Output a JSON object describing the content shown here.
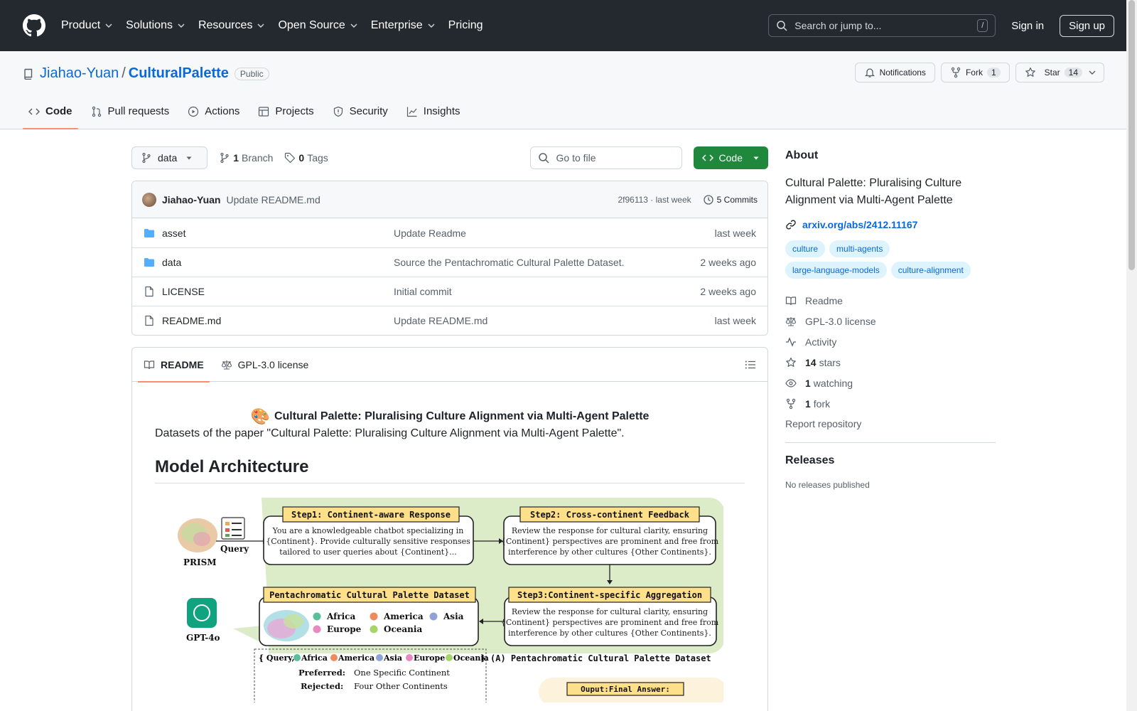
{
  "header": {
    "nav": [
      "Product",
      "Solutions",
      "Resources",
      "Open Source",
      "Enterprise",
      "Pricing"
    ],
    "search_placeholder": "Search or jump to...",
    "search_key": "/",
    "signin": "Sign in",
    "signup": "Sign up"
  },
  "repo": {
    "owner": "Jiahao-Yuan",
    "separator": "/",
    "name": "CulturalPalette",
    "visibility": "Public",
    "notifications": "Notifications",
    "fork_label": "Fork",
    "fork_count": "1",
    "star_label": "Star",
    "star_count": "14"
  },
  "tabs": [
    "Code",
    "Pull requests",
    "Actions",
    "Projects",
    "Security",
    "Insights"
  ],
  "toolbar": {
    "branch": "data",
    "branch_count": "1",
    "branch_label": "Branch",
    "tag_count": "0",
    "tag_label": "Tags",
    "goto_placeholder": "Go to file",
    "code_label": "Code"
  },
  "commit": {
    "author": "Jiahao-Yuan",
    "message": "Update README.md",
    "sha_time": "2f96113 · last week",
    "commits": "5 Commits"
  },
  "files": [
    {
      "type": "folder",
      "name": "asset",
      "message": "Update Readme",
      "age": "last week"
    },
    {
      "type": "folder",
      "name": "data",
      "message": "Source the Pentachromatic Cultural Palette Dataset.",
      "age": "2 weeks ago"
    },
    {
      "type": "file",
      "name": "LICENSE",
      "message": "Initial commit",
      "age": "2 weeks ago"
    },
    {
      "type": "file",
      "name": "README.md",
      "message": "Update README.md",
      "age": "last week"
    }
  ],
  "readme": {
    "tab_readme": "README",
    "tab_license": "GPL-3.0 license",
    "title": "Cultural Palette: Pluralising Culture Alignment via Multi-Agent Palette",
    "description": "Datasets of the paper \"Cultural Palette: Pluralising Culture Alignment via Multi-Agent Palette\".",
    "h2": "Model Architecture",
    "diagram": {
      "prism": "PRISM",
      "query": "Query",
      "gpt": "GPT-4o",
      "step1": "Step1: Continent-aware Response",
      "step1_text": [
        "You are a knowledgeable chatbot specializing in",
        "{Continent}. Provide culturally sensitive responses",
        "tailored to user queries about {Continent}..."
      ],
      "step2": "Step2: Cross-continent Feedback",
      "step2_text": [
        "Review the response for cultural clarity, ensuring",
        "{Continent} perspectives are prominent and free from",
        "interference by other cultures {Other Continents}."
      ],
      "step3": "Step3:Continent-specific Aggregation",
      "step3_text": [
        "Review the response for cultural clarity, ensuring",
        "{Continent} perspectives are prominent and free from",
        "interference by other cultures {Other Continents}."
      ],
      "dataset": "Pentachromatic Cultural Palette Dataset",
      "continents": [
        {
          "name": "Africa",
          "color": "#5bbf9a"
        },
        {
          "name": "America",
          "color": "#f08a5d"
        },
        {
          "name": "Asia",
          "color": "#8fa3d6"
        },
        {
          "name": "Europe",
          "color": "#e88ac0"
        },
        {
          "name": "Oceania",
          "color": "#a6d46a"
        }
      ],
      "legend_open": "{ Query,",
      "legend_close": "}",
      "caption_a": "(A) Pentachromatic Cultural Palette Dataset",
      "preferred_label": "Preferred:",
      "preferred": "One Specific Continent",
      "rejected_label": "Rejected:",
      "rejected": "Four Other Continents",
      "output": "Ouput:Final Answer:"
    }
  },
  "about": {
    "heading": "About",
    "description": "Cultural Palette: Pluralising Culture Alignment via Multi-Agent Palette",
    "link": "arxiv.org/abs/2412.11167",
    "topics": [
      "culture",
      "multi-agents",
      "large-language-models",
      "culture-alignment"
    ],
    "readme": "Readme",
    "license": "GPL-3.0 license",
    "activity": "Activity",
    "stars_count": "14",
    "stars_label": "stars",
    "watching_count": "1",
    "watching_label": "watching",
    "forks_count": "1",
    "forks_label": "fork",
    "report": "Report repository"
  },
  "releases": {
    "heading": "Releases",
    "empty": "No releases published"
  },
  "colors": {
    "header_bg": "#24292f",
    "link": "#0969da",
    "code_button": "#1f883d",
    "active_tab_underline": "#fd8c73",
    "diagram_green": "#dcebc8",
    "step_label_bg": "#ffe08a"
  }
}
